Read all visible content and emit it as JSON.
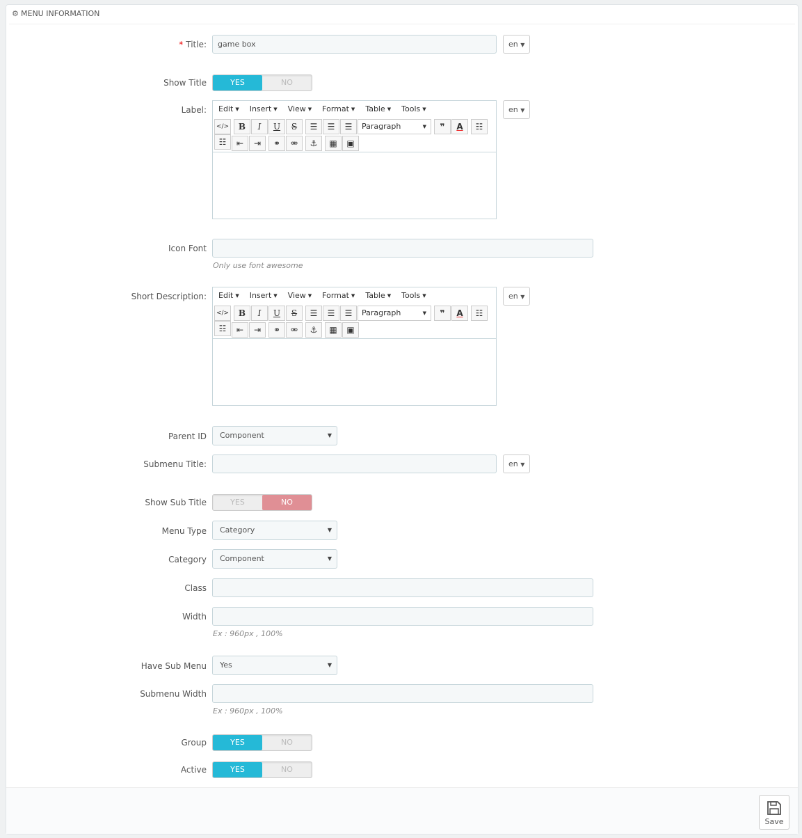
{
  "panel": {
    "heading": "MENU INFORMATION",
    "heading_icon": "cogs-icon"
  },
  "fields": {
    "title": {
      "label": "Title:",
      "required_mark": "*",
      "value": "game box",
      "lang": "en"
    },
    "show_title": {
      "label": "Show Title",
      "yes": "YES",
      "no": "NO",
      "selected": "yes"
    },
    "label": {
      "label": "Label:",
      "lang": "en"
    },
    "icon_font": {
      "label": "Icon Font",
      "value": "",
      "help": "Only use font awesome"
    },
    "short_description": {
      "label": "Short Description:",
      "lang": "en"
    },
    "parent_id": {
      "label": "Parent ID",
      "value": "Component"
    },
    "submenu_title": {
      "label": "Submenu Title:",
      "value": "",
      "lang": "en"
    },
    "show_sub_title": {
      "label": "Show Sub Title",
      "yes": "YES",
      "no": "NO",
      "selected": "no"
    },
    "menu_type": {
      "label": "Menu Type",
      "value": "Category"
    },
    "category": {
      "label": "Category",
      "value": "Component"
    },
    "class": {
      "label": "Class",
      "value": ""
    },
    "width": {
      "label": "Width",
      "value": "",
      "help": "Ex : 960px , 100%"
    },
    "have_sub_menu": {
      "label": "Have Sub Menu",
      "value": "Yes"
    },
    "submenu_width": {
      "label": "Submenu Width",
      "value": "",
      "help": "Ex : 960px , 100%"
    },
    "group": {
      "label": "Group",
      "yes": "YES",
      "no": "NO",
      "selected": "yes"
    },
    "active": {
      "label": "Active",
      "yes": "YES",
      "no": "NO",
      "selected": "yes"
    }
  },
  "editor": {
    "menus": [
      "Edit",
      "Insert",
      "View",
      "Format",
      "Table",
      "Tools"
    ],
    "block_format": "Paragraph",
    "toolbar_icons": [
      "code-icon",
      "bold-icon",
      "italic-icon",
      "underline-icon",
      "strikethrough-icon",
      "align-left-icon",
      "align-center-icon",
      "align-right-icon",
      "blockquote-icon",
      "text-color-icon",
      "bullet-list-icon",
      "numbered-list-icon",
      "outdent-icon",
      "indent-icon",
      "link-icon",
      "unlink-icon",
      "anchor-icon",
      "media-icon",
      "image-icon"
    ]
  },
  "footer": {
    "save_label": "Save"
  },
  "colors": {
    "toggle_on": "#25b9d7",
    "toggle_no_on": "#e08f95",
    "required": "#ee0000"
  }
}
